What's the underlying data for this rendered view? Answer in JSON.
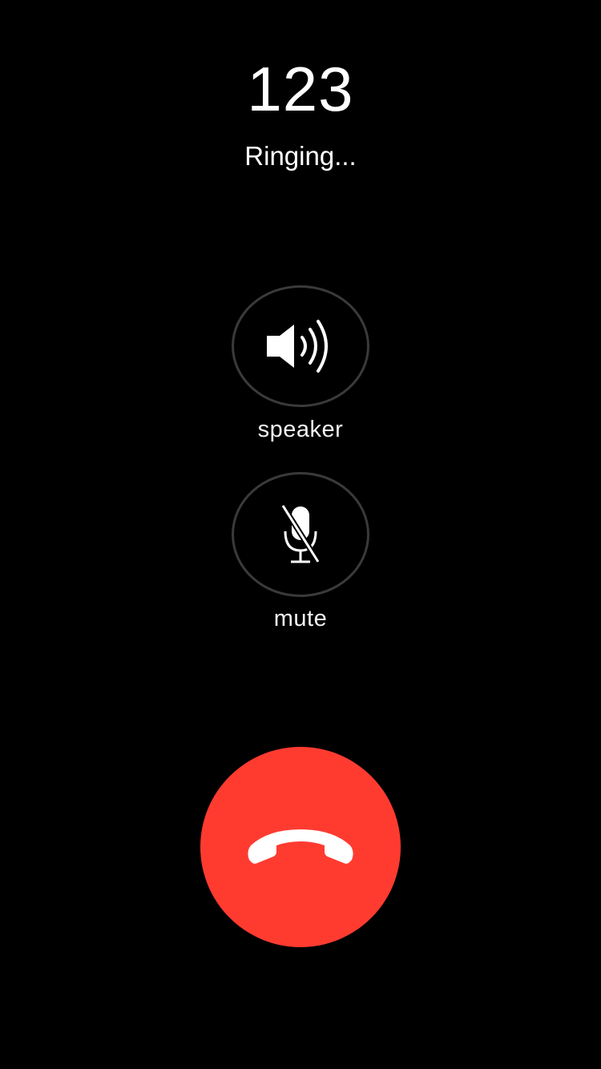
{
  "call": {
    "caller": "123",
    "status": "Ringing..."
  },
  "controls": {
    "speaker": {
      "label": "speaker",
      "icon": "speaker-icon"
    },
    "mute": {
      "label": "mute",
      "icon": "microphone-muted-icon"
    }
  },
  "end_call": {
    "icon": "phone-hangup-icon"
  },
  "colors": {
    "background": "#000000",
    "text": "#ffffff",
    "control_border": "#3a3a3a",
    "end_call": "#ff3b30"
  }
}
